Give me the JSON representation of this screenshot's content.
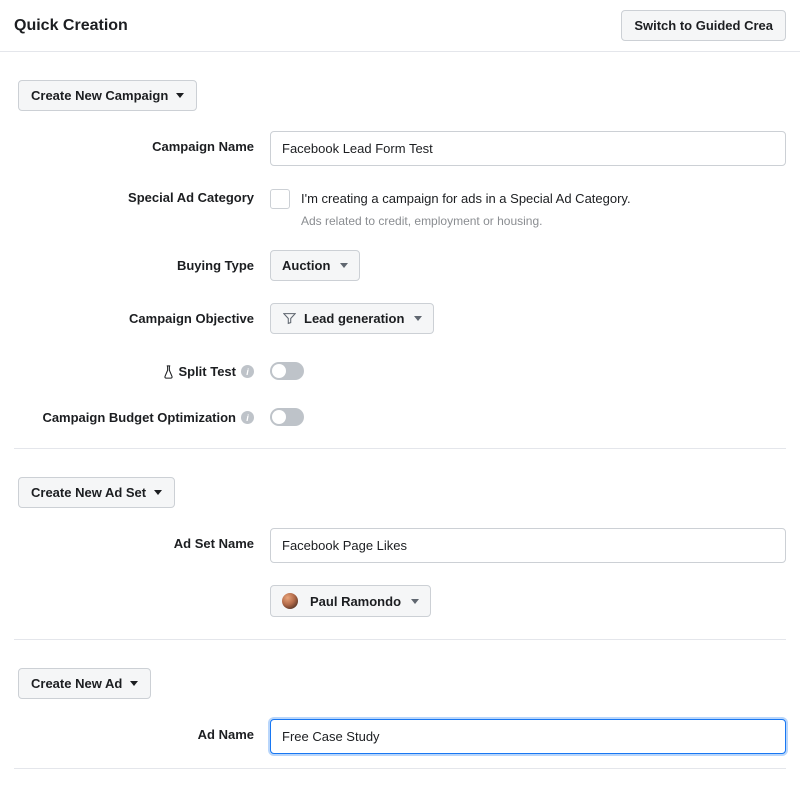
{
  "header": {
    "title": "Quick Creation",
    "switch_button": "Switch to Guided Crea"
  },
  "campaign": {
    "section_button": "Create New Campaign",
    "labels": {
      "name": "Campaign Name",
      "special_ad": "Special Ad Category",
      "buying_type": "Buying Type",
      "objective": "Campaign Objective",
      "split_test": "Split Test",
      "cbo": "Campaign Budget Optimization"
    },
    "name_value": "Facebook Lead Form Test",
    "special_ad_text": "I'm creating a campaign for ads in a Special Ad Category.",
    "special_ad_helper": "Ads related to credit, employment or housing.",
    "buying_type_value": "Auction",
    "objective_value": "Lead generation"
  },
  "adset": {
    "section_button": "Create New Ad Set",
    "labels": {
      "name": "Ad Set Name"
    },
    "name_value": "Facebook Page Likes",
    "page_value": "Paul Ramondo"
  },
  "ad": {
    "section_button": "Create New Ad",
    "labels": {
      "name": "Ad Name"
    },
    "name_value": "Free Case Study"
  }
}
